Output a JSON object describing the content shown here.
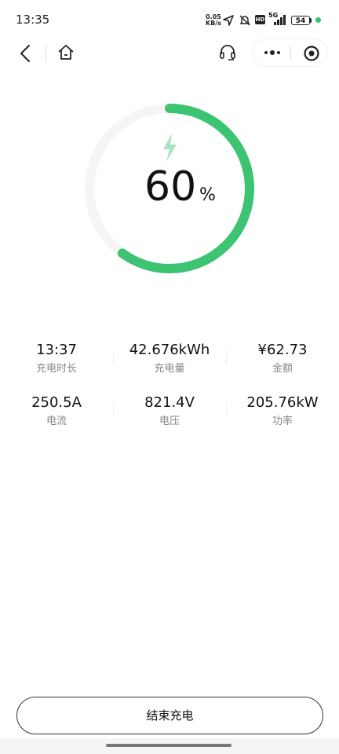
{
  "status_bar": {
    "time": "13:35",
    "net_speed_value": "0.05",
    "net_speed_unit": "KB/s",
    "hd_badge": "HD",
    "network": "5G",
    "battery": "54",
    "icons": [
      "location-arrow-icon",
      "mute-icon",
      "hd-icon",
      "signal-icon",
      "battery-icon"
    ]
  },
  "nav": {
    "icons": [
      "back-icon",
      "home-icon",
      "headset-icon",
      "more-icon",
      "close-target-icon"
    ]
  },
  "progress": {
    "percent": "60",
    "unit": "%",
    "fraction": 0.6,
    "ring_color": "#3cc473",
    "track_color": "#f5f5f5",
    "bolt_color": "#a8e4c1"
  },
  "stats": [
    {
      "value": "13:37",
      "label": "充电时长"
    },
    {
      "value": "42.676kWh",
      "label": "充电量"
    },
    {
      "value": "¥62.73",
      "label": "金额"
    },
    {
      "value": "250.5A",
      "label": "电流"
    },
    {
      "value": "821.4V",
      "label": "电压"
    },
    {
      "value": "205.76kW",
      "label": "功率"
    }
  ],
  "end_button": {
    "label": "结束充电"
  }
}
